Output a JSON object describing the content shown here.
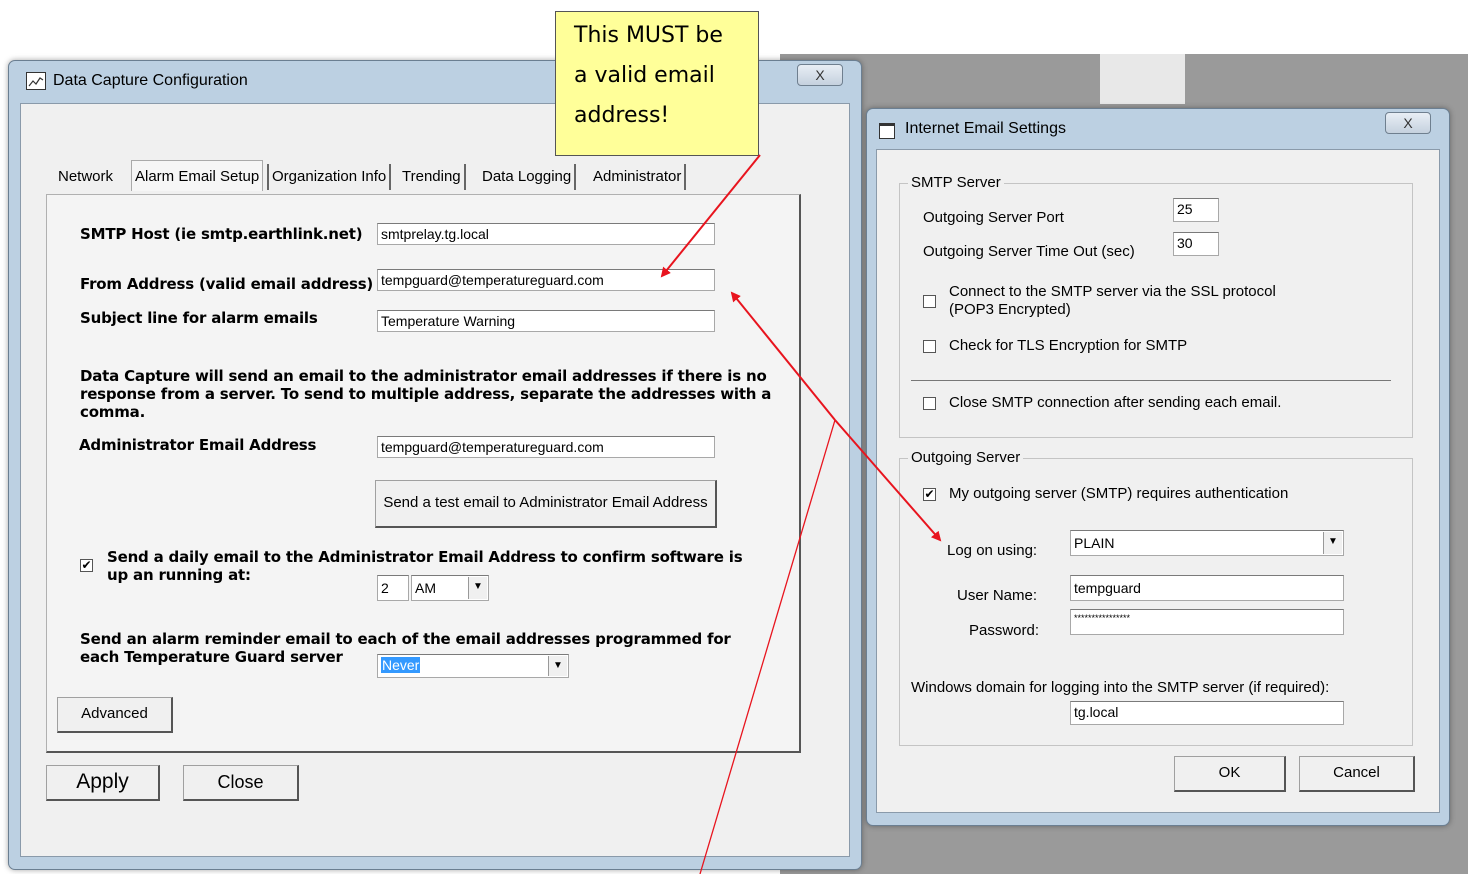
{
  "dialog_main": {
    "title": "Data Capture Configuration",
    "close_glyph": "X",
    "tabs": [
      {
        "label": "Network"
      },
      {
        "label": "Alarm Email Setup"
      },
      {
        "label": "Organization Info"
      },
      {
        "label": "Trending"
      },
      {
        "label": "Data Logging"
      },
      {
        "label": "Administrator"
      }
    ],
    "active_tab": "Alarm Email Setup",
    "smtp_host": {
      "label": "SMTP Host (ie smtp.earthlink.net)",
      "value": "smtprelay.tg.local"
    },
    "from_address": {
      "label": "From Address (valid email address)",
      "value": "tempguard@temperatureguard.com"
    },
    "subject": {
      "label": "Subject line for alarm emails",
      "value": "Temperature Warning"
    },
    "info_text": "Data Capture will send an email to the administrator email addresses if there is no response from a server.  To send to multiple address, separate the addresses with a comma.",
    "admin_email": {
      "label": "Administrator Email Address",
      "value": "tempguard@temperatureguard.com"
    },
    "test_button": "Send a test email to Administrator Email Address",
    "daily_email": {
      "checked": true,
      "label": "Send a daily email to the Administrator Email Address to confirm software is up an running at:",
      "hour": "2",
      "ampm": "AM"
    },
    "reminder": {
      "label": "Send an alarm reminder email to each of the email addresses programmed for each Temperature Guard server",
      "value": "Never"
    },
    "advanced_button": "Advanced",
    "apply_button": "Apply",
    "close_button": "Close"
  },
  "dialog_email": {
    "title": "Internet Email Settings",
    "close_glyph": "X",
    "smtp_group": "SMTP Server",
    "port": {
      "label": "Outgoing Server Port",
      "value": "25"
    },
    "timeout": {
      "label": "Outgoing Server Time Out (sec)",
      "value": "30"
    },
    "ssl": {
      "checked": false,
      "label": "Connect to the SMTP server via the SSL protocol (POP3 Encrypted)"
    },
    "tls": {
      "checked": false,
      "label": "Check for TLS Encryption for SMTP"
    },
    "close_conn": {
      "checked": false,
      "label": "Close SMTP connection after sending each email."
    },
    "outgoing_group": "Outgoing Server",
    "auth": {
      "checked": true,
      "label": "My outgoing server (SMTP) requires authentication"
    },
    "logon": {
      "label": "Log on using:",
      "value": "PLAIN"
    },
    "username": {
      "label": "User Name:",
      "value": "tempguard"
    },
    "password": {
      "label": "Password:",
      "value": "****************"
    },
    "domain": {
      "label": "Windows domain for logging into the SMTP server (if required):",
      "value": "tg.local"
    },
    "ok_button": "OK",
    "cancel_button": "Cancel"
  },
  "callout": {
    "text": "This MUST be a valid email address!"
  },
  "colors": {
    "arrow": "#e8141e",
    "callout_bg": "#ffff99"
  }
}
